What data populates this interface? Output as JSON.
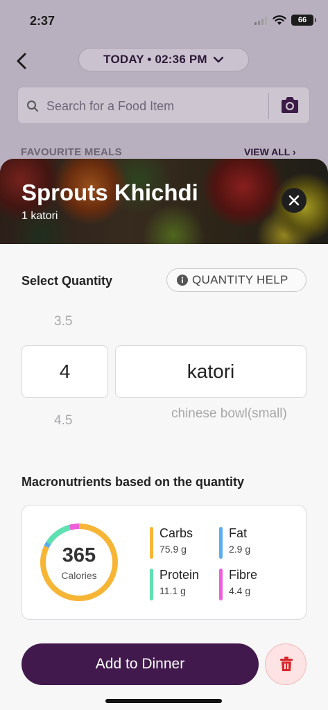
{
  "status_bar": {
    "time": "2:37",
    "battery": "66"
  },
  "header": {
    "date_label": "TODAY • 02:36 PM"
  },
  "search": {
    "placeholder": "Search for a Food Item"
  },
  "favourites": {
    "title": "FAVOURITE MEALS",
    "view_all": "VIEW ALL"
  },
  "food": {
    "name": "Sprouts Khichdi",
    "serving": "1 katori"
  },
  "quantity": {
    "title": "Select Quantity",
    "help_label": "QUANTITY HELP",
    "prev_value": "3.5",
    "value": "4",
    "next_value": "4.5",
    "unit": "katori",
    "next_unit": "chinese bowl(small)"
  },
  "macros": {
    "title": "Macronutrients based on the quantity",
    "calories": "365",
    "calories_label": "Calories",
    "items": [
      {
        "name": "Carbs",
        "value": "75.9 g",
        "color": "#f7b536"
      },
      {
        "name": "Fat",
        "value": "2.9 g",
        "color": "#5aaef0"
      },
      {
        "name": "Protein",
        "value": "11.1 g",
        "color": "#5fe0b0"
      },
      {
        "name": "Fibre",
        "value": "4.4 g",
        "color": "#ee5fd9"
      }
    ]
  },
  "actions": {
    "add_label": "Add to Dinner"
  },
  "colors": {
    "primary": "#42194d",
    "danger": "#d8262b"
  }
}
